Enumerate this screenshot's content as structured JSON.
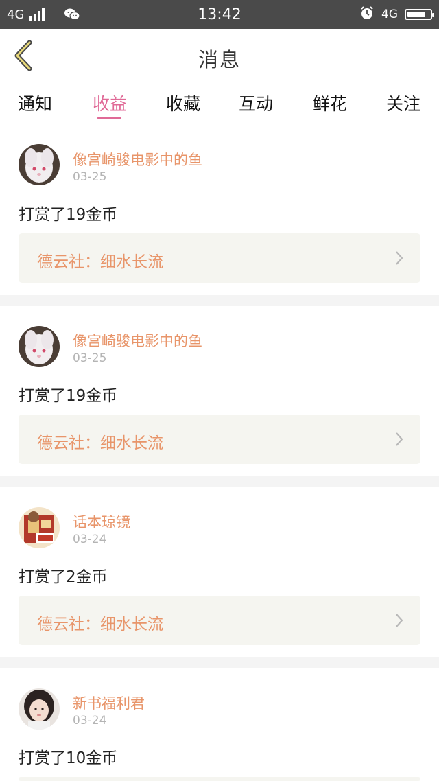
{
  "status_bar": {
    "network_left": "4G",
    "time": "13:42",
    "network_right": "4G"
  },
  "header": {
    "title": "消息"
  },
  "tabs": [
    {
      "label": "通知"
    },
    {
      "label": "收益"
    },
    {
      "label": "收藏"
    },
    {
      "label": "互动"
    },
    {
      "label": "鲜花"
    },
    {
      "label": "关注"
    }
  ],
  "active_tab": "收益",
  "colors": {
    "accent": "#e06a97",
    "name": "#e8956a",
    "date": "#b4b4b4",
    "ref_bg": "#f5f5f0"
  },
  "items": [
    {
      "name": "像宫崎骏电影中的鱼",
      "date": "03-25",
      "message": "打赏了19金币",
      "ref": "德云社：细水长流",
      "avatar": "rabbit-avatar"
    },
    {
      "name": "像宫崎骏电影中的鱼",
      "date": "03-25",
      "message": "打赏了19金币",
      "ref": "德云社：细水长流",
      "avatar": "rabbit-avatar"
    },
    {
      "name": "话本琼镜",
      "date": "03-24",
      "message": "打赏了2金币",
      "ref": "德云社：细水长流",
      "avatar": "book-avatar"
    },
    {
      "name": "新书福利君",
      "date": "03-24",
      "message": "打赏了10金币",
      "ref": "",
      "avatar": "girl-avatar"
    }
  ]
}
